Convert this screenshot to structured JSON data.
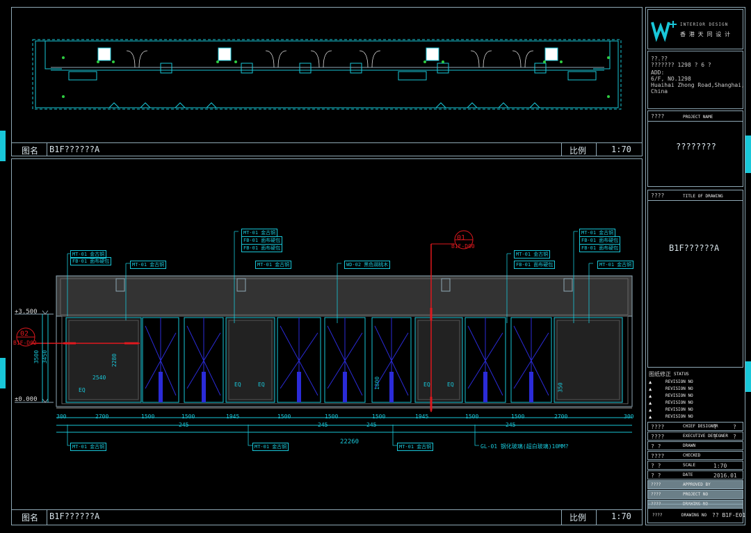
{
  "top_panel": {
    "name_label": "图名",
    "drawing_name": "B1F??????A",
    "scale_label": "比例",
    "scale_value": "1:70"
  },
  "bottom_panel": {
    "name_label": "图名",
    "drawing_name": "B1F??????A",
    "scale_label": "比例",
    "scale_value": "1:70"
  },
  "elevation": {
    "level_top": "+3.500",
    "level_bottom": "±0.000",
    "height_marks": [
      "3500",
      "3450"
    ],
    "section_01": {
      "number": "01",
      "ref": "B1F-D00"
    },
    "section_02": {
      "number": "02",
      "ref": "B1F-D02"
    },
    "interior_dims": [
      "2280",
      "2540",
      "EQ",
      "EQ",
      "EQ",
      "EQ",
      "EQ",
      "1800",
      "350"
    ],
    "bottom_dims_row1": [
      "300",
      "2700",
      "1500",
      "1500",
      "1945",
      "1500",
      "1500",
      "1500",
      "1945",
      "1500",
      "1500",
      "2700",
      "300"
    ],
    "bottom_dims_row2": [
      "245",
      "245",
      "245",
      "245"
    ],
    "overall_dim": "22260",
    "gl_note": "GL-01  钢化玻璃(超白玻璃)10MM?",
    "callouts_top": [
      "MT-01  金古铜",
      "FB-01  面布硬包",
      "MT-01  金古铜",
      "MT-01  金古铜",
      "FB-01  面布硬包",
      "FB-01  面布硬包",
      "MT-01  金古铜",
      "WD-02  黑色胡桃木",
      "MT-01  金古铜",
      "FB-01  面布硬包",
      "MT-01  金古铜",
      "FB-01  面布硬包",
      "FB-01  面布硬包",
      "MT-01  金古铜"
    ],
    "callouts_bottom": [
      "MT-01  金古铜",
      "MT-01  金古铜",
      "MT-01  金古铜"
    ]
  },
  "title_block": {
    "logo_text": "INTERIOR DESIGN",
    "logo_cn": "香 港 天 同 设 计",
    "address_line1": "??.??",
    "address_line2": "??????? 1298 ? 6 ?",
    "address_line3": "ADD:",
    "address_line4": "6/F, NO.1298",
    "address_line5": "Huaihai Zhong Road,Shanghai,",
    "address_line6": "China",
    "project_label_cn": "????",
    "project_label_en": "PROJECT NAME",
    "project_value": "????????",
    "title_label_cn": "????",
    "title_label_en": "TITLE OF DRAWING",
    "title_value": "B1F??????A",
    "revision_header_cn": "图纸修正",
    "revision_header_en": "STATUS",
    "revisions": [
      "REVISION NO",
      "REVISION NO",
      "REVISION NO",
      "REVISION NO",
      "REVISION NO",
      "REVISION NO"
    ],
    "rows": [
      {
        "cn": "????",
        "en": "CHIEF DESIGNER",
        "v1": "?",
        "v2": "?"
      },
      {
        "cn": "????",
        "en": "EXECUTIVE DESIGNER",
        "v1": "?",
        "v2": "?"
      },
      {
        "cn": "?  ?",
        "en": "DRAWN",
        "v1": "",
        "v2": ""
      },
      {
        "cn": "????",
        "en": "CHECKED",
        "v1": "",
        "v2": ""
      },
      {
        "cn": "?  ?",
        "en": "SCALE",
        "v1": "1:70",
        "v2": ""
      },
      {
        "cn": "?  ?",
        "en": "DATE",
        "v1": "2016.01",
        "v2": ""
      }
    ],
    "highlight_rows": [
      {
        "cn": "????",
        "en": "APPROVED BY"
      },
      {
        "cn": "????",
        "en": "PROJECT NO"
      },
      {
        "cn": "????",
        "en": "DRAWING NO"
      }
    ],
    "drawing_no_label_cn": "????",
    "drawing_no_label_en": "DRAWING NO",
    "drawing_no_value": "?? B1F-E01"
  },
  "colors": {
    "cyan": "#19c7d9",
    "frame": "#8fa9b6",
    "red": "#e0181e",
    "blue": "#2b2bd8",
    "wall": "#3a3a3a"
  }
}
